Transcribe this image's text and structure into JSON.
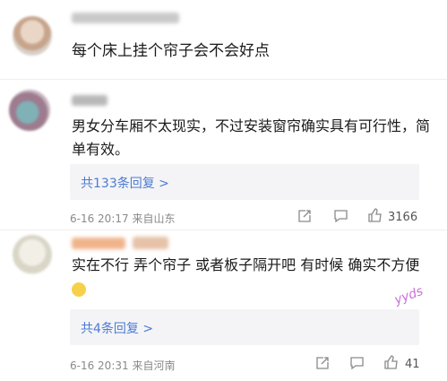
{
  "comments": [
    {
      "text": "每个床上挂个帘子会不会好点"
    },
    {
      "text": "男女分车厢不太现实，不过安装窗帘确实具有可行性，简单有效。",
      "replies_label": "共133条回复 >",
      "time": "6-16 20:17",
      "location": "来自山东",
      "likes": "3166"
    },
    {
      "text": "实在不行 弄个帘子 或者板子隔开吧 有时候 确实不方便",
      "replies_label": "共4条回复 >",
      "time": "6-16 20:31",
      "location": "来自河南",
      "likes": "41"
    }
  ],
  "watermark": "yyds",
  "icons": [
    "share-icon",
    "comment-icon",
    "thumbs-up-icon",
    "emoji-icon"
  ]
}
